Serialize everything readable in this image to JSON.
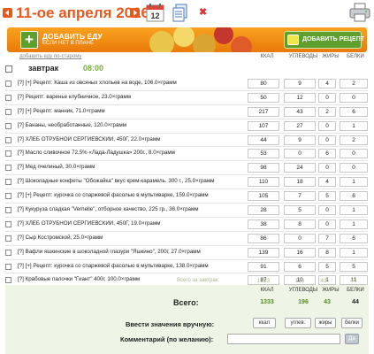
{
  "header": {
    "date_title": "11-ое апреля 2016",
    "prev_icon": "arrow-left-icon",
    "next_icon": "arrow-right-icon",
    "calendar_icon": "calendar-icon",
    "copy_icon": "copy-document-icon",
    "delete_icon": "close-icon",
    "print_icon": "printer-icon"
  },
  "banner": {
    "add_food_label": "ДОБАВИТЬ ЕДУ",
    "add_food_sub": "ЕСЛИ НЕТ В ПЛАНЕ",
    "add_recipe_label": "ДОБАВИТЬ РЕЦЕПТ"
  },
  "old_style_link": "добавить еду по-старому",
  "columns": [
    "ККАЛ",
    "УГЛЕВОДЫ",
    "ЖИРЫ",
    "БЕЛКИ"
  ],
  "meal": {
    "name": "завтрак",
    "time": "08:00"
  },
  "items": [
    {
      "name": "[?] [+] Рецепт: Каша из овсяных хлопьев на воде, 106.0×грамм",
      "kcal": "80",
      "carbs": "9",
      "fat": "4",
      "protein": "2"
    },
    {
      "name": "[?] Рецепт: варенье клубничное, 23.0×грамм",
      "kcal": "50",
      "carbs": "12",
      "fat": "0",
      "protein": "0"
    },
    {
      "name": "[?] [+] Рецепт: манник, 71.0×грамм",
      "kcal": "217",
      "carbs": "43",
      "fat": "2",
      "protein": "6"
    },
    {
      "name": "[?] Бананы, необработанные, 120.0×грамм",
      "kcal": "107",
      "carbs": "27",
      "fat": "0",
      "protein": "1"
    },
    {
      "name": "[?] ХЛЕБ ОТРУБНОЙ СЕРГИЕВСКИЙ, 450Г, 22.0×грамм",
      "kcal": "44",
      "carbs": "9",
      "fat": "0",
      "protein": "2"
    },
    {
      "name": "[?] Масло сливочное 72,5% «Лада-Ладушка» 200г., 8.0×грамм",
      "kcal": "53",
      "carbs": "0",
      "fat": "6",
      "protein": "0"
    },
    {
      "name": "[?] Мед пчелиный, 30.0×грамм",
      "kcal": "98",
      "carbs": "24",
      "fat": "0",
      "protein": "0"
    },
    {
      "name": "[?] Шоколадные конфеты \"Обожайка\" вкус крем-карамель. 300 г., 25.0×грамм",
      "kcal": "110",
      "carbs": "18",
      "fat": "4",
      "protein": "1"
    },
    {
      "name": "[?] [+] Рецепт: курочка со спаржевой фасолью в мультиварке, 159.0×грамм",
      "kcal": "105",
      "carbs": "7",
      "fat": "5",
      "protein": "6"
    },
    {
      "name": "[?] Кукуруза сладкая \"Vernelle\", отборное качество, 225 гр., 36.0×грамм",
      "kcal": "28",
      "carbs": "5",
      "fat": "0",
      "protein": "1"
    },
    {
      "name": "[?] ХЛЕБ ОТРУБНОЙ СЕРГИЕВСКИЙ, 450Г, 19.0×грамм",
      "kcal": "38",
      "carbs": "8",
      "fat": "0",
      "protein": "1"
    },
    {
      "name": "[?] Сыр Костромской, 25.0×грамм",
      "kcal": "86",
      "carbs": "0",
      "fat": "7",
      "protein": "6"
    },
    {
      "name": "[?] Вафли яшкинские в шоколадной глазури \"Яшкино\", 200г, 27.0×грамм",
      "kcal": "139",
      "carbs": "16",
      "fat": "8",
      "protein": "1"
    },
    {
      "name": "[?] [+] Рецепт: курочка со спаржевой фасолью в мультиварке, 138.0×грамм",
      "kcal": "91",
      "carbs": "6",
      "fat": "5",
      "protein": "5"
    },
    {
      "name": "[?] Крабовые палочки \"Гиант\" 400г, 100.0×грамм",
      "kcal": "87",
      "carbs": "10",
      "fat": "1",
      "protein": "11"
    }
  ],
  "breakfast_total": {
    "label": "Всего за завтрак:",
    "kcal": "1333",
    "carbs": "196",
    "fat": "43",
    "protein": "44"
  },
  "footer": {
    "columns": [
      "ККАЛ",
      "УГЛЕВОДЫ",
      "ЖИРЫ",
      "БЕЛКИ"
    ],
    "total_label": "Всего:",
    "total": {
      "kcal": "1333",
      "carbs": "196",
      "fat": "43",
      "protein": "44"
    },
    "manual_label": "Ввести значения вручную:",
    "manual_buttons": [
      "ккал",
      "углев.",
      "жиры",
      "белки"
    ],
    "comment_label": "Комментарий (по желанию):",
    "ok_label": "Да"
  },
  "colors": {
    "accent": "#e8581c",
    "green": "#5f9f2f",
    "banner": "#f2921a"
  }
}
